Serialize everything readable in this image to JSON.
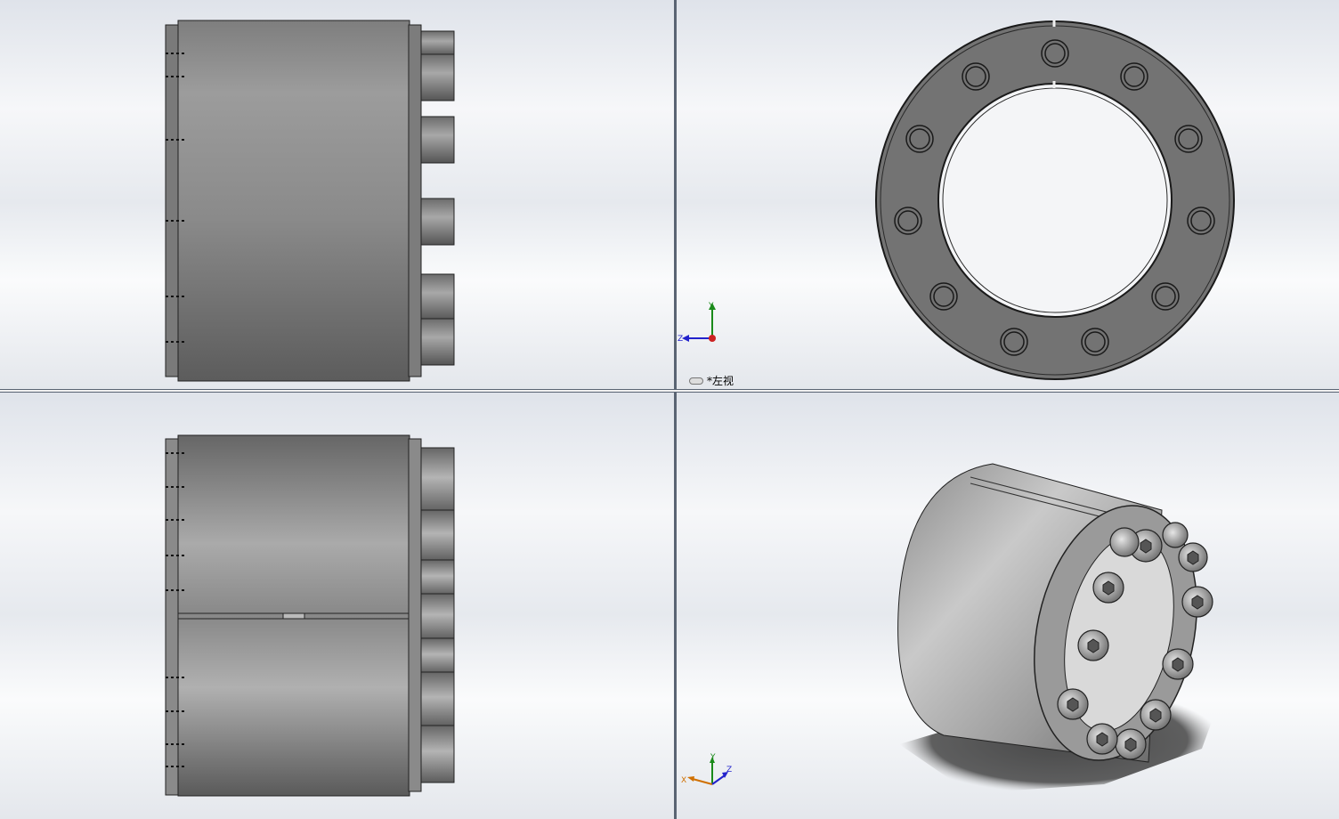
{
  "viewports": {
    "top_left": {
      "name": "front-view"
    },
    "top_right": {
      "name": "left-view",
      "label": "*左视"
    },
    "bottom_left": {
      "name": "top-view"
    },
    "bottom_right": {
      "name": "isometric-view"
    }
  },
  "triads": {
    "left_view": {
      "y": "Y",
      "z": "Z"
    },
    "iso_view": {
      "x": "X",
      "y": "Y",
      "z": "Z"
    }
  },
  "colors": {
    "background_top": "#dfe3ea",
    "part_gray": "#9a9a9a",
    "part_dark": "#6b6b6b",
    "edge": "#1a1a1a",
    "axis_x": "#cc2222",
    "axis_y": "#1a8a1a",
    "axis_z": "#2222cc"
  }
}
